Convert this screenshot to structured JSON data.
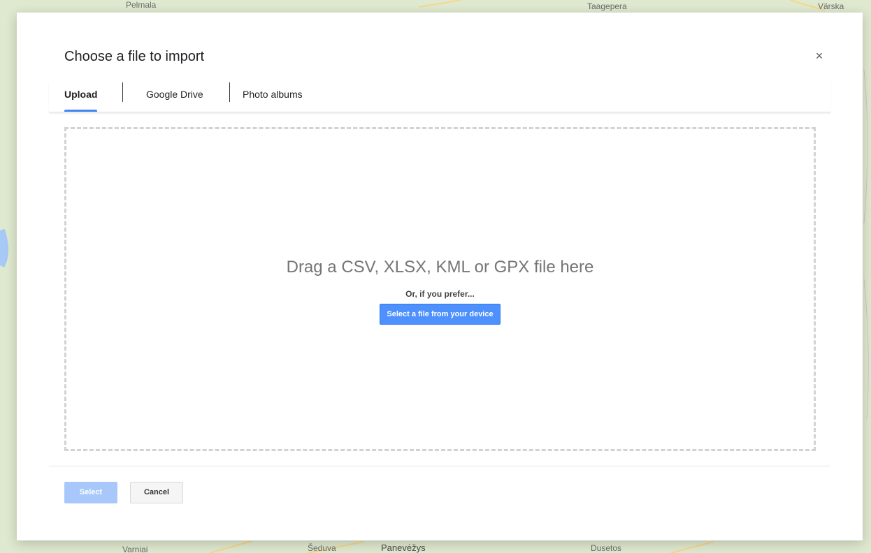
{
  "background": {
    "map_labels": [
      {
        "name": "map-label-top-left",
        "text": "Pelmala"
      },
      {
        "name": "map-label-taagepera",
        "text": "Taagepera"
      },
      {
        "name": "map-label-varska",
        "text": "Värska"
      },
      {
        "name": "map-label-seduva",
        "text": "Šeduva"
      },
      {
        "name": "map-label-panevezys",
        "text": "Panevėžys"
      },
      {
        "name": "map-label-dusetos",
        "text": "Dusetos"
      },
      {
        "name": "map-label-varniai",
        "text": "Varniai"
      }
    ]
  },
  "dialog": {
    "title": "Choose a file to import",
    "close_symbol": "×",
    "tabs": [
      {
        "label": "Upload",
        "active": true
      },
      {
        "label": "Google Drive",
        "active": false
      },
      {
        "label": "Photo albums",
        "active": false
      }
    ],
    "dropzone": {
      "drag_text": "Drag a CSV, XLSX, KML or GPX file here",
      "or_text": "Or, if you prefer...",
      "select_device_label": "Select a file from your device"
    },
    "footer": {
      "select_label": "Select",
      "select_enabled": false,
      "cancel_label": "Cancel"
    }
  },
  "colors": {
    "accent": "#4285f4",
    "primary_button": "#4d90fe",
    "disabled_button": "#a8c8fb",
    "map_background": "#dfe9cf"
  },
  "icons": {
    "close": "close-icon"
  }
}
